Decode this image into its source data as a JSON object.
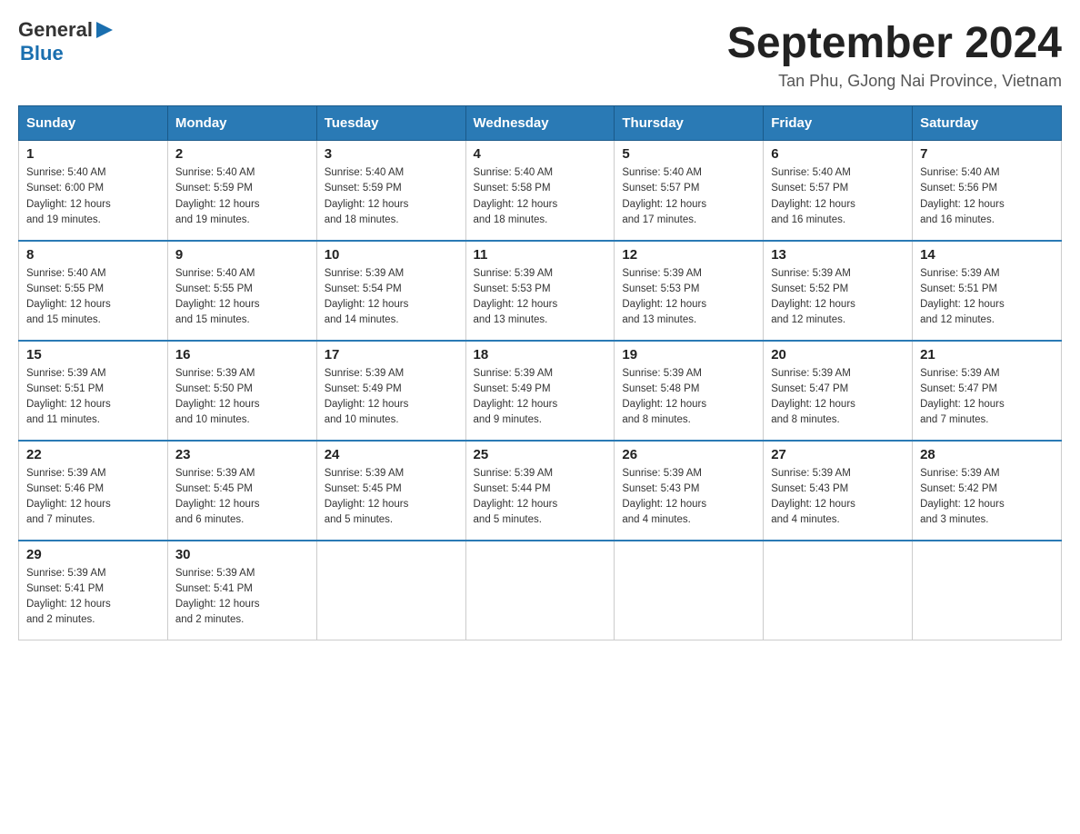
{
  "header": {
    "logo_general": "General",
    "logo_blue": "Blue",
    "title": "September 2024",
    "subtitle": "Tan Phu, GJong Nai Province, Vietnam"
  },
  "days_of_week": [
    "Sunday",
    "Monday",
    "Tuesday",
    "Wednesday",
    "Thursday",
    "Friday",
    "Saturday"
  ],
  "weeks": [
    [
      {
        "day": "1",
        "sunrise": "5:40 AM",
        "sunset": "6:00 PM",
        "daylight": "12 hours and 19 minutes."
      },
      {
        "day": "2",
        "sunrise": "5:40 AM",
        "sunset": "5:59 PM",
        "daylight": "12 hours and 19 minutes."
      },
      {
        "day": "3",
        "sunrise": "5:40 AM",
        "sunset": "5:59 PM",
        "daylight": "12 hours and 18 minutes."
      },
      {
        "day": "4",
        "sunrise": "5:40 AM",
        "sunset": "5:58 PM",
        "daylight": "12 hours and 18 minutes."
      },
      {
        "day": "5",
        "sunrise": "5:40 AM",
        "sunset": "5:57 PM",
        "daylight": "12 hours and 17 minutes."
      },
      {
        "day": "6",
        "sunrise": "5:40 AM",
        "sunset": "5:57 PM",
        "daylight": "12 hours and 16 minutes."
      },
      {
        "day": "7",
        "sunrise": "5:40 AM",
        "sunset": "5:56 PM",
        "daylight": "12 hours and 16 minutes."
      }
    ],
    [
      {
        "day": "8",
        "sunrise": "5:40 AM",
        "sunset": "5:55 PM",
        "daylight": "12 hours and 15 minutes."
      },
      {
        "day": "9",
        "sunrise": "5:40 AM",
        "sunset": "5:55 PM",
        "daylight": "12 hours and 15 minutes."
      },
      {
        "day": "10",
        "sunrise": "5:39 AM",
        "sunset": "5:54 PM",
        "daylight": "12 hours and 14 minutes."
      },
      {
        "day": "11",
        "sunrise": "5:39 AM",
        "sunset": "5:53 PM",
        "daylight": "12 hours and 13 minutes."
      },
      {
        "day": "12",
        "sunrise": "5:39 AM",
        "sunset": "5:53 PM",
        "daylight": "12 hours and 13 minutes."
      },
      {
        "day": "13",
        "sunrise": "5:39 AM",
        "sunset": "5:52 PM",
        "daylight": "12 hours and 12 minutes."
      },
      {
        "day": "14",
        "sunrise": "5:39 AM",
        "sunset": "5:51 PM",
        "daylight": "12 hours and 12 minutes."
      }
    ],
    [
      {
        "day": "15",
        "sunrise": "5:39 AM",
        "sunset": "5:51 PM",
        "daylight": "12 hours and 11 minutes."
      },
      {
        "day": "16",
        "sunrise": "5:39 AM",
        "sunset": "5:50 PM",
        "daylight": "12 hours and 10 minutes."
      },
      {
        "day": "17",
        "sunrise": "5:39 AM",
        "sunset": "5:49 PM",
        "daylight": "12 hours and 10 minutes."
      },
      {
        "day": "18",
        "sunrise": "5:39 AM",
        "sunset": "5:49 PM",
        "daylight": "12 hours and 9 minutes."
      },
      {
        "day": "19",
        "sunrise": "5:39 AM",
        "sunset": "5:48 PM",
        "daylight": "12 hours and 8 minutes."
      },
      {
        "day": "20",
        "sunrise": "5:39 AM",
        "sunset": "5:47 PM",
        "daylight": "12 hours and 8 minutes."
      },
      {
        "day": "21",
        "sunrise": "5:39 AM",
        "sunset": "5:47 PM",
        "daylight": "12 hours and 7 minutes."
      }
    ],
    [
      {
        "day": "22",
        "sunrise": "5:39 AM",
        "sunset": "5:46 PM",
        "daylight": "12 hours and 7 minutes."
      },
      {
        "day": "23",
        "sunrise": "5:39 AM",
        "sunset": "5:45 PM",
        "daylight": "12 hours and 6 minutes."
      },
      {
        "day": "24",
        "sunrise": "5:39 AM",
        "sunset": "5:45 PM",
        "daylight": "12 hours and 5 minutes."
      },
      {
        "day": "25",
        "sunrise": "5:39 AM",
        "sunset": "5:44 PM",
        "daylight": "12 hours and 5 minutes."
      },
      {
        "day": "26",
        "sunrise": "5:39 AM",
        "sunset": "5:43 PM",
        "daylight": "12 hours and 4 minutes."
      },
      {
        "day": "27",
        "sunrise": "5:39 AM",
        "sunset": "5:43 PM",
        "daylight": "12 hours and 4 minutes."
      },
      {
        "day": "28",
        "sunrise": "5:39 AM",
        "sunset": "5:42 PM",
        "daylight": "12 hours and 3 minutes."
      }
    ],
    [
      {
        "day": "29",
        "sunrise": "5:39 AM",
        "sunset": "5:41 PM",
        "daylight": "12 hours and 2 minutes."
      },
      {
        "day": "30",
        "sunrise": "5:39 AM",
        "sunset": "5:41 PM",
        "daylight": "12 hours and 2 minutes."
      },
      null,
      null,
      null,
      null,
      null
    ]
  ],
  "labels": {
    "sunrise": "Sunrise:",
    "sunset": "Sunset:",
    "daylight": "Daylight:"
  }
}
